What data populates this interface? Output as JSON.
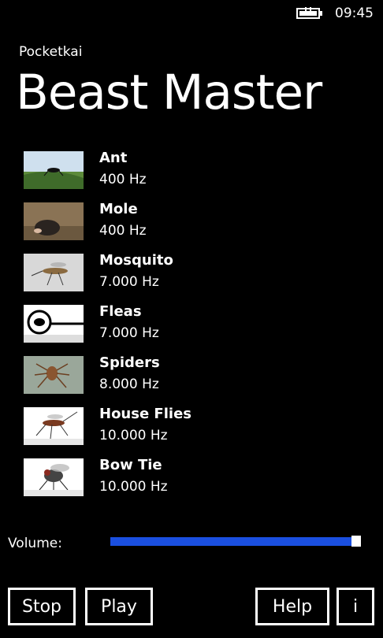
{
  "status": {
    "time": "09:45"
  },
  "app": {
    "name": "Pocketkai",
    "title": "Beast Master"
  },
  "items": [
    {
      "name": "Ant",
      "freq": "400 Hz"
    },
    {
      "name": "Mole",
      "freq": "400 Hz"
    },
    {
      "name": "Mosquito",
      "freq": "7.000 Hz"
    },
    {
      "name": "Fleas",
      "freq": "7.000 Hz"
    },
    {
      "name": "Spiders",
      "freq": "8.000 Hz"
    },
    {
      "name": "House Flies",
      "freq": "10.000 Hz"
    },
    {
      "name": "Bow Tie",
      "freq": "10.000 Hz"
    }
  ],
  "volume": {
    "label": "Volume:",
    "level": 0.98,
    "color": "#1a4fe0"
  },
  "buttons": {
    "stop": "Stop",
    "play": "Play",
    "help": "Help",
    "info": "i"
  }
}
